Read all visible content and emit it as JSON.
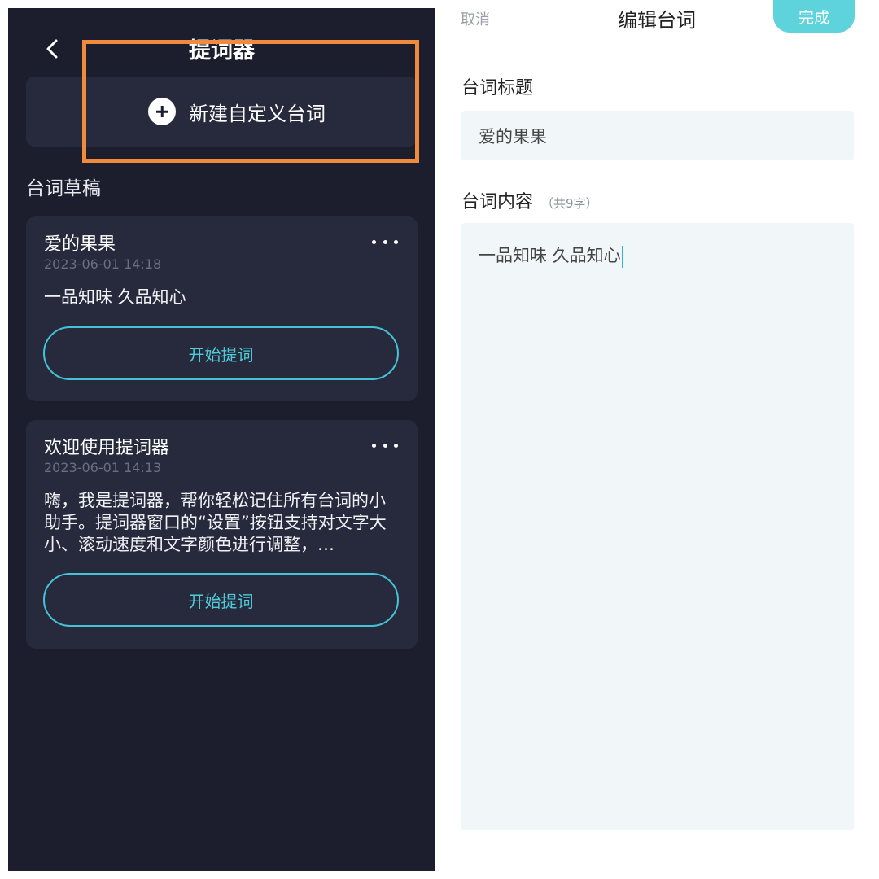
{
  "left_panel": {
    "header": {
      "title": "提词器",
      "back_icon": "chevron-left-icon"
    },
    "new_button": {
      "label": "新建自定义台词",
      "icon": "plus-circle-icon"
    },
    "section_title": "台词草稿",
    "drafts": [
      {
        "title": "爱的果果",
        "date": "2023-06-01 14:18",
        "body": "一品知味 久品知心",
        "action": "开始提词"
      },
      {
        "title": "欢迎使用提词器",
        "date": "2023-06-01 14:13",
        "body": "嗨，我是提词器，帮你轻松记住所有台词的小助手。提词器窗口的“设置”按钮支持对文字大小、滚动速度和文字颜色进行调整，…",
        "action": "开始提词"
      }
    ],
    "colors": {
      "background": "#1c1e2e",
      "card": "#272a3c",
      "accent": "#45c3d6",
      "highlight": "#f08a3c"
    }
  },
  "right_panel": {
    "header": {
      "cancel": "取消",
      "title": "编辑台词",
      "done": "完成"
    },
    "title_field": {
      "label": "台词标题",
      "value": "爱的果果"
    },
    "content_field": {
      "label": "台词内容",
      "count": "（共9字）",
      "value": "一品知味 久品知心"
    },
    "colors": {
      "done_button": "#5fd3dc",
      "field_background": "#f1f6f9",
      "caret": "#2fb7c8"
    }
  }
}
